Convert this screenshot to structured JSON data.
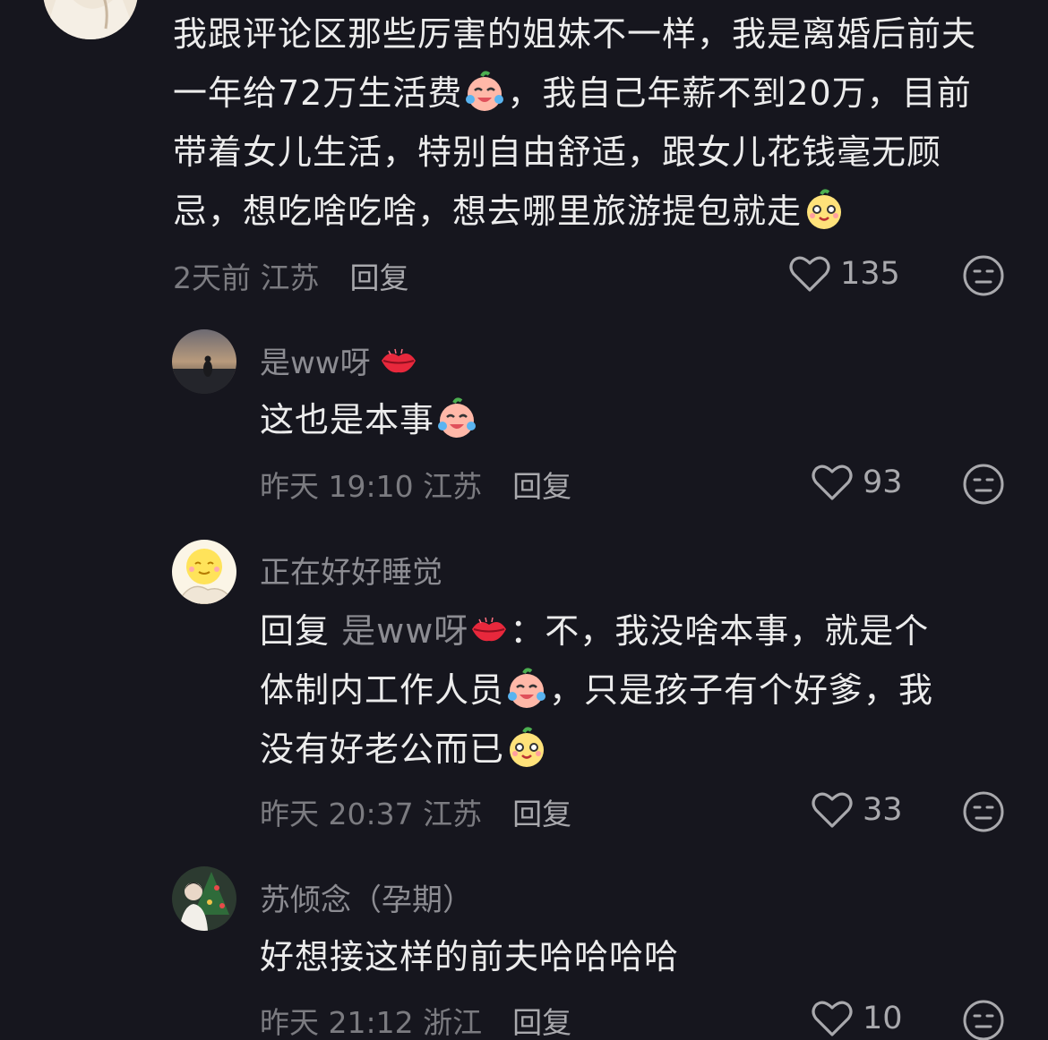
{
  "comments": [
    {
      "username": "",
      "text_parts": [
        "我跟评论区那些厉害的姐妹不一样，我是离婚后前夫一年给72万生活费",
        "，我自己年薪不到20万，目前带着女儿生活，特别自由舒适，跟女儿花钱毫无顾忌，想吃啥吃啥，想去哪里旅游提包就走"
      ],
      "time_location": "2天前 江苏",
      "reply_label": "回复",
      "likes": "135"
    },
    {
      "username": "是ww呀",
      "text": "这也是本事",
      "time_location": "昨天 19:10 江苏",
      "reply_label": "回复",
      "likes": "93"
    },
    {
      "username": "正在好好睡觉",
      "reply_prefix": "回复",
      "reply_to": "是ww呀",
      "line1": "：不，我没啥本事，就是个",
      "line2": "体制内工作人员",
      "line2b": "，只是孩子有个好爹，我",
      "line3": "没有好老公而已",
      "time_location": "昨天 20:37 江苏",
      "reply_label": "回复",
      "likes": "33"
    },
    {
      "username": "苏倾念（孕期）",
      "text": "好想接这样的前夫哈哈哈哈",
      "time_location": "昨天 21:12 浙江",
      "reply_label": "回复",
      "likes": "10"
    }
  ],
  "icons": {
    "like": "heart-outline-icon",
    "react": "meh-face-icon",
    "emoji_cry": "crying-laughing-emoji",
    "emoji_smug": "smug-face-emoji",
    "emoji_kiss": "lips-emoji"
  },
  "colors": {
    "background": "#16161e",
    "primary_text": "#ececec",
    "secondary_text": "#7b7b80"
  }
}
